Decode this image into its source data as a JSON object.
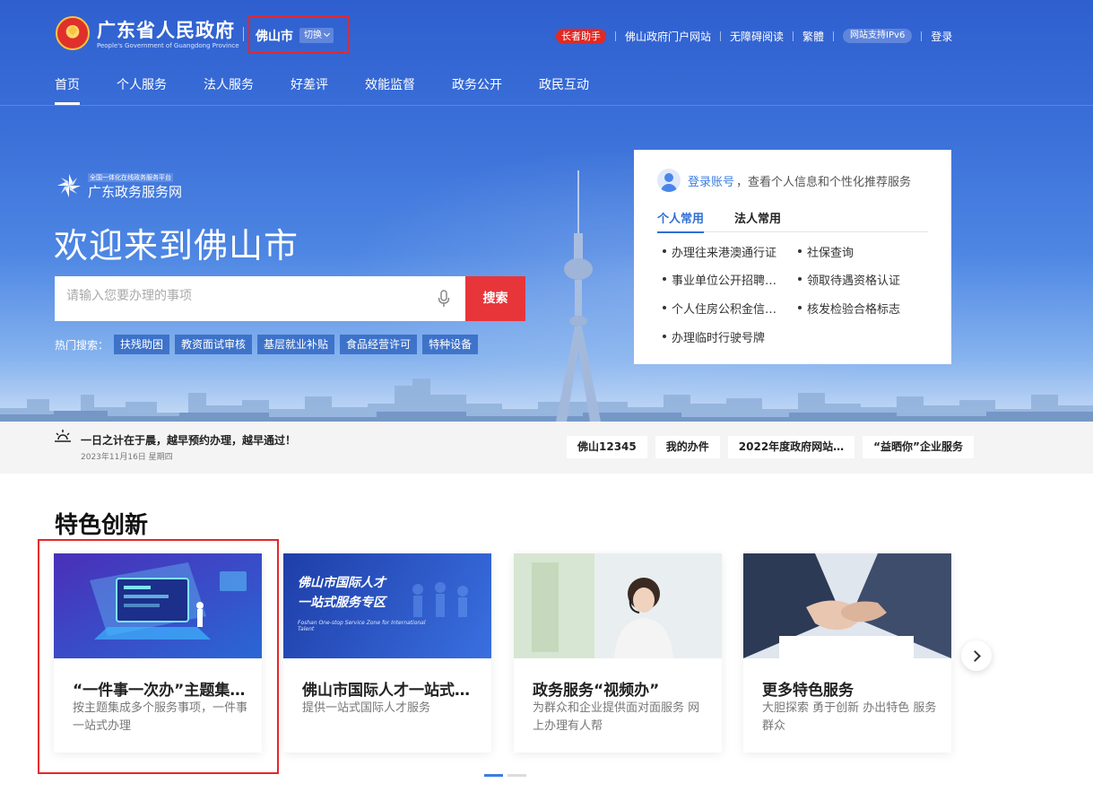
{
  "header": {
    "site_title": "广东省人民政府",
    "site_subtitle": "People's Government of Guangdong Province",
    "city": "佛山市",
    "switch_label": "切换",
    "links": {
      "elder": "长者助手",
      "portal": "佛山政府门户网站",
      "accessible": "无障碍阅读",
      "traditional": "繁體",
      "ipv6": "网站支持IPv6",
      "login": "登录"
    }
  },
  "nav": [
    "首页",
    "个人服务",
    "法人服务",
    "好差评",
    "效能监督",
    "政务公开",
    "政民互动"
  ],
  "hero": {
    "platform_top": "全国一体化在线政务服务平台",
    "platform_name": "广东政务服务网",
    "welcome": "欢迎来到佛山市",
    "search_placeholder": "请输入您要办理的事项",
    "search_button": "搜索",
    "hot_label": "热门搜索：",
    "hot_tags": [
      "扶残助困",
      "教资面试审核",
      "基层就业补贴",
      "食品经营许可",
      "特种设备"
    ]
  },
  "panel": {
    "login_link": "登录账号",
    "login_tip": "，查看个人信息和个性化推荐服务",
    "tabs": [
      "个人常用",
      "法人常用"
    ],
    "services": [
      "办理往来港澳通行证",
      "社保查询",
      "事业单位公开招聘…",
      "领取待遇资格认证",
      "个人住房公积金信…",
      "核发检验合格标志",
      "办理临时行驶号牌"
    ]
  },
  "notice": {
    "text": "一日之计在于晨，越早预约办理，越早通过！",
    "date": "2023年11月16日 星期四",
    "quick_links": [
      "佛山12345",
      "我的办件",
      "2022年度政府网站…",
      "“益晒你”企业服务"
    ]
  },
  "features": {
    "title": "特色创新",
    "cards": [
      {
        "title": "“一件事一次办”主题集…",
        "desc": "按主题集成多个服务事项，一件事一站式办理"
      },
      {
        "title": "佛山市国际人才一站式…",
        "desc": "提供一站式国际人才服务",
        "img_text_1": "佛山市国际人才",
        "img_text_2": "一站式服务专区",
        "img_text_en": "Foshan One-stop Service Zone for International Talent"
      },
      {
        "title": "政务服务“视频办”",
        "desc": "为群众和企业提供面对面服务 网上办理有人帮"
      },
      {
        "title": "更多特色服务",
        "desc": "大胆探索 勇于创新 办出特色 服务群众"
      }
    ]
  },
  "colors": {
    "brand_blue": "#2f5fcf",
    "accent_red": "#e8353a",
    "link_blue": "#3b7de0"
  }
}
